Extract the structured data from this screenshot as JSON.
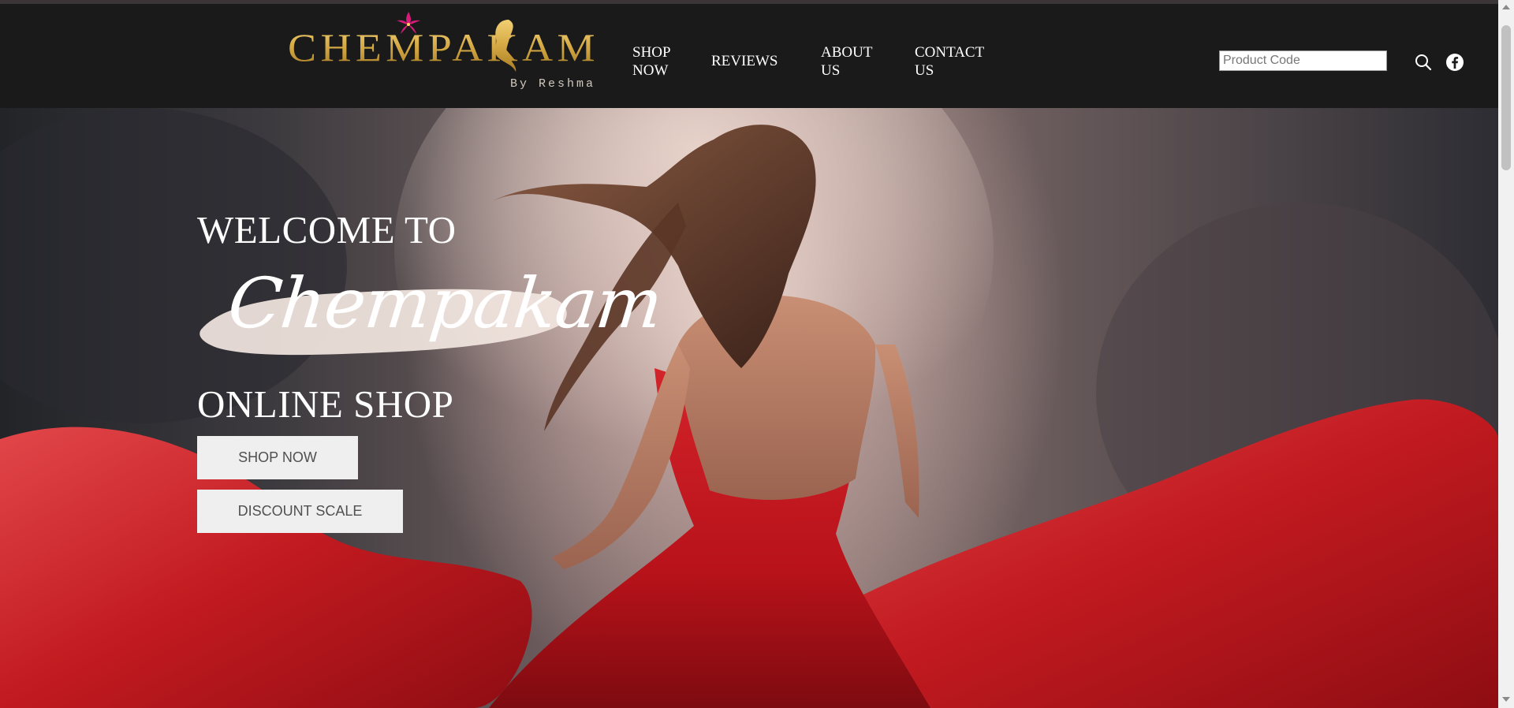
{
  "brand": {
    "logo_text": "CHEMPAKAM",
    "logo_subtext": "By Reshma"
  },
  "nav": {
    "items": [
      {
        "label": "SHOP NOW"
      },
      {
        "label": "REVIEWS"
      },
      {
        "label": "ABOUT US"
      },
      {
        "label": "CONTACT US"
      }
    ]
  },
  "search": {
    "placeholder": "Product Code",
    "value": ""
  },
  "icons": {
    "search": "search-icon",
    "facebook": "facebook-icon",
    "flower": "flower-icon"
  },
  "hero": {
    "welcome": "WELCOME TO",
    "script_brand": "Chempakam",
    "subtitle": "ONLINE SHOP",
    "buttons": [
      {
        "label": "SHOP NOW"
      },
      {
        "label": "DISCOUNT SCALE"
      }
    ]
  },
  "colors": {
    "header_bg": "#1b1a1a",
    "logo_gold": "#d4a843",
    "flower_pink": "#d81b7a",
    "dress_red": "#c8161e",
    "button_bg": "#efefef"
  }
}
